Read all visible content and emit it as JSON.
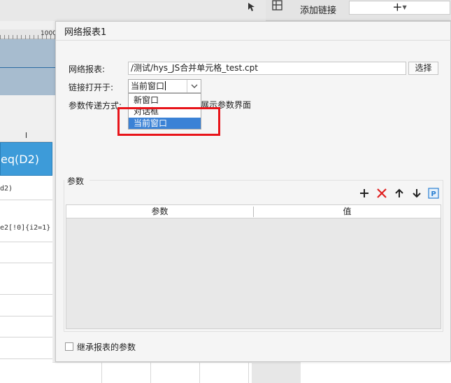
{
  "toolbar": {
    "add_link_label": "添加链接",
    "add_link_button": "+",
    "ruler_number": "1000"
  },
  "sheet": {
    "column_header": "I",
    "blue_cell_text": "eq(D2)",
    "row_texts": [
      "d2)",
      "e2[!0]{i2=1}"
    ]
  },
  "dialog": {
    "title": "网络报表1",
    "report_label": "网络报表:",
    "report_path": "/测试/hys_JS合并单元格_test.cpt",
    "select_button": "选择",
    "open_in_label": "链接打开于:",
    "open_in_value": "当前窗口",
    "options": [
      "新窗口",
      "对话框",
      "当前窗口"
    ],
    "param_pass_label": "参数传递方式:",
    "param_pass_tail": "展示参数界面",
    "params_section": "参数",
    "table_headers": [
      "参数",
      "值"
    ],
    "inherit_label": "继承报表的参数",
    "colors": {
      "selected": "#3b82d6",
      "highlight": "#e8141a",
      "delete": "#e02020",
      "p_icon": "#2a7fd1"
    }
  }
}
